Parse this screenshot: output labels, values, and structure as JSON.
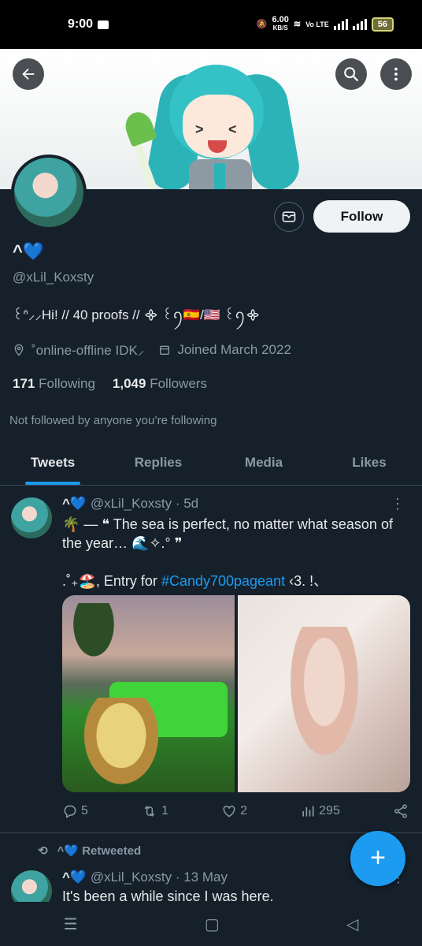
{
  "status_bar": {
    "time": "9:00",
    "net_speed": "6.00",
    "net_unit": "KB/S",
    "volte": "Vo LTE",
    "battery": "56"
  },
  "profile": {
    "display_name": "^💙",
    "handle": "@xLil_Koxsty",
    "bio": "꒰ᐢ⸝⸝Hi!  //  40 proofs // ᯽ ꒰ꪆ🇪🇸/🇺🇸 ꒰ꪆ᯽",
    "location": "˚online-offline IDK⸝",
    "joined": "Joined March 2022",
    "following_count": "171",
    "following_label": "Following",
    "followers_count": "1,049",
    "followers_label": "Followers",
    "not_followed": "Not followed by anyone you’re following",
    "follow_label": "Follow"
  },
  "tabs": [
    "Tweets",
    "Replies",
    "Media",
    "Likes"
  ],
  "tweet1": {
    "name": "^💙",
    "handle": "@xLil_Koxsty",
    "time": "· 5d",
    "text": "🌴 — ❝ The sea is perfect, no matter what season of the year… 🌊✧.° ❞",
    "text2_prefix": ".˚₊🏖️, Entry for ",
    "hashtag": "#Candy700pageant",
    "text2_suffix": " ‹3.  !、",
    "replies": "5",
    "retweets": "1",
    "likes": "2",
    "views": "295"
  },
  "retweeted": {
    "name": "^💙",
    "label": "Retweeted"
  },
  "tweet2": {
    "name": "^💙",
    "handle": "@xLil_Koxsty",
    "time": "· 13 May",
    "text": "It's been a while since I was here."
  },
  "fab": "+"
}
